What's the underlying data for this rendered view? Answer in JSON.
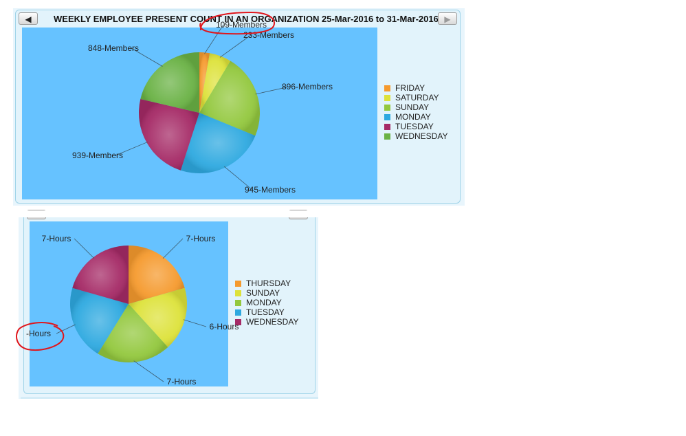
{
  "colors": {
    "panel_bg": "#e8f5fc",
    "plot_bg": "#66c2ff",
    "annotation": "#e0161c"
  },
  "top": {
    "title": "WEEKLY EMPLOYEE PRESENT COUNT IN AN ORGANIZATION 25-Mar-2016 to 31-Mar-2016",
    "prev_label": "◀",
    "next_label": "▶"
  },
  "chart_data": [
    {
      "type": "pie",
      "title": "WEEKLY EMPLOYEE PRESENT COUNT IN AN ORGANIZATION 25-Mar-2016 to 31-Mar-2016",
      "unit": "Members",
      "slices": [
        {
          "name": "FRIDAY",
          "value": 109,
          "label": "109-Members",
          "color": "#f59a2e"
        },
        {
          "name": "SATURDAY",
          "value": 233,
          "label": "233-Members",
          "color": "#dde23a"
        },
        {
          "name": "SUNDAY",
          "value": 896,
          "label": "896-Members",
          "color": "#93c83e"
        },
        {
          "name": "MONDAY",
          "value": 945,
          "label": "945-Members",
          "color": "#2ea9e0"
        },
        {
          "name": "TUESDAY",
          "value": 939,
          "label": "939-Members",
          "color": "#a52a66"
        },
        {
          "name": "WEDNESDAY",
          "value": 848,
          "label": "848-Members",
          "color": "#6ab245"
        }
      ],
      "legend_position": "right"
    },
    {
      "type": "pie",
      "title": "",
      "unit": "Hours",
      "slices": [
        {
          "name": "THURSDAY",
          "value": 7,
          "label": "7-Hours",
          "color": "#f59a2e"
        },
        {
          "name": "SUNDAY",
          "value": 6,
          "label": "6-Hours",
          "color": "#dde23a"
        },
        {
          "name": "MONDAY",
          "value": 7,
          "label": "7-Hours",
          "color": "#93c83e"
        },
        {
          "name": "TUESDAY",
          "value": 7,
          "label": "-Hours",
          "color": "#2ea9e0"
        },
        {
          "name": "WEDNESDAY",
          "value": 7,
          "label": "7-Hours",
          "color": "#a52a66"
        }
      ],
      "legend_position": "right"
    }
  ]
}
